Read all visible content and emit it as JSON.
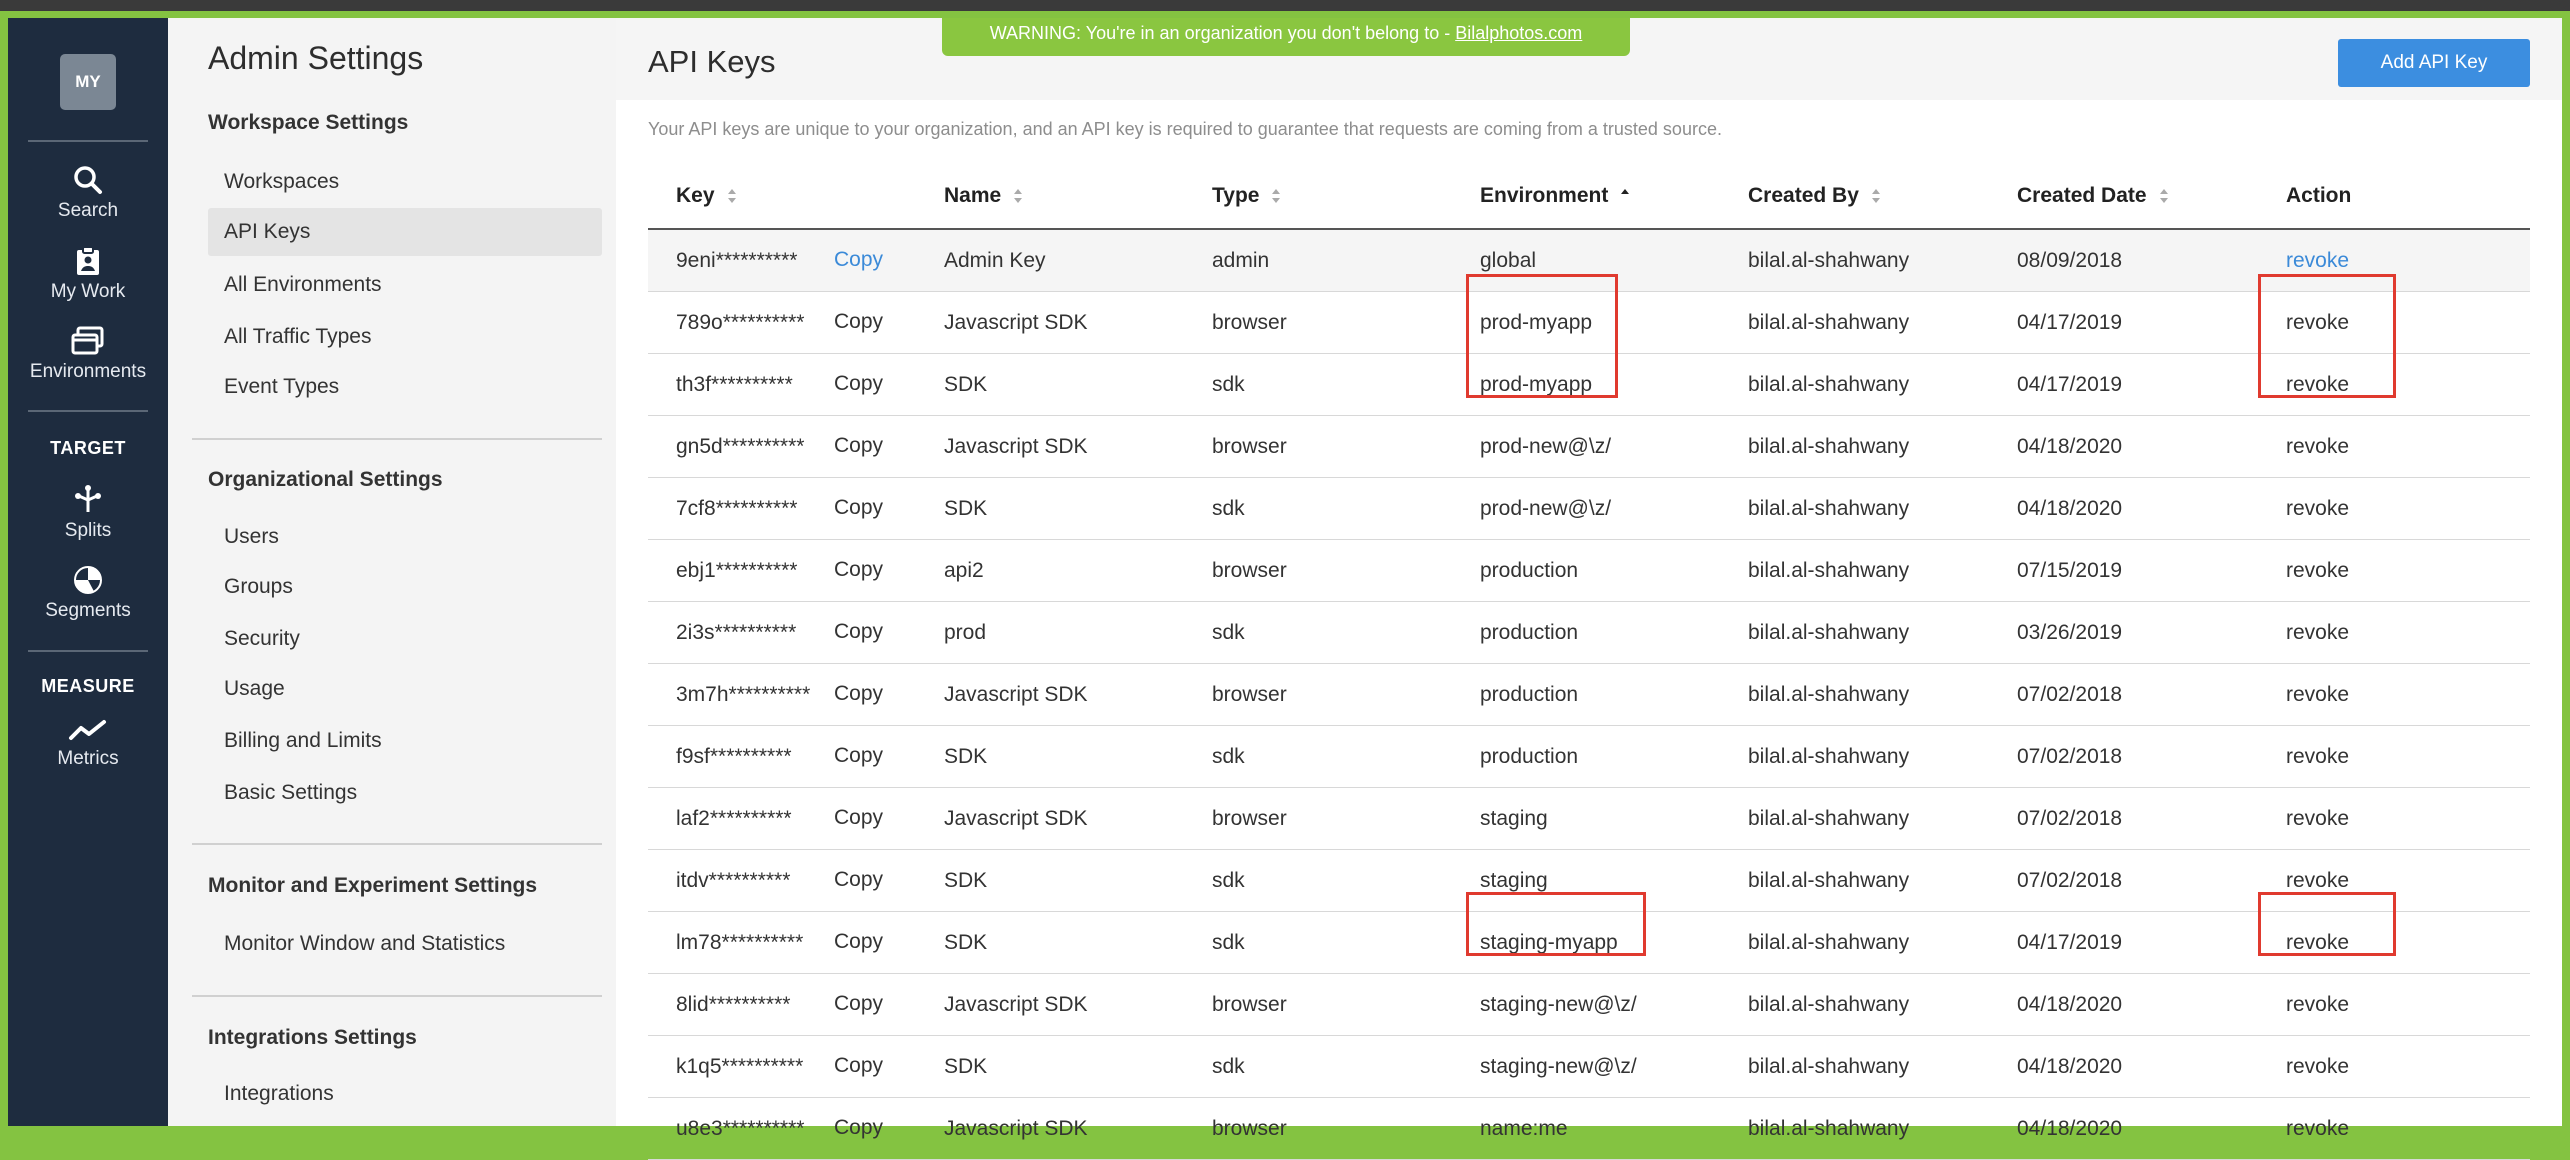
{
  "nav": {
    "avatar": "MY",
    "items": [
      {
        "label": "Search",
        "icon": "search-icon"
      },
      {
        "label": "My Work",
        "icon": "clipboard-icon"
      },
      {
        "label": "Environments",
        "icon": "windows-icon"
      }
    ],
    "target_heading": "TARGET",
    "target_items": [
      {
        "label": "Splits",
        "icon": "splits-icon"
      },
      {
        "label": "Segments",
        "icon": "pie-icon"
      }
    ],
    "measure_heading": "MEASURE",
    "measure_items": [
      {
        "label": "Metrics",
        "icon": "metrics-icon"
      }
    ]
  },
  "settings": {
    "title": "Admin Settings",
    "workspace": {
      "title": "Workspace Settings",
      "items": [
        "Workspaces",
        "API Keys",
        "All Environments",
        "All Traffic Types",
        "Event Types"
      ]
    },
    "org": {
      "title": "Organizational Settings",
      "items": [
        "Users",
        "Groups",
        "Security",
        "Usage",
        "Billing and Limits",
        "Basic Settings"
      ]
    },
    "monitor": {
      "title": "Monitor and Experiment Settings",
      "items": [
        "Monitor Window and Statistics"
      ]
    },
    "integrations": {
      "title": "Integrations Settings",
      "items": [
        "Integrations"
      ]
    }
  },
  "main": {
    "title": "API Keys",
    "add_button": "Add API Key",
    "warning_text": "WARNING: You're in an organization you don't belong to - ",
    "warning_link": "Bilalphotos.com",
    "description": "Your API keys are unique to your organization, and an API key is required to guarantee that requests are coming from a trusted source.",
    "columns": [
      "Key",
      "Name",
      "Type",
      "Environment",
      "Created By",
      "Created Date",
      "Action"
    ],
    "copy_label": "Copy",
    "rows": [
      {
        "key": "9eni**********",
        "name": "Admin Key",
        "type": "admin",
        "env": "global",
        "by": "bilal.al-shahwany",
        "date": "08/09/2018",
        "action": "revoke"
      },
      {
        "key": "789o**********",
        "name": "Javascript SDK",
        "type": "browser",
        "env": "prod-myapp",
        "by": "bilal.al-shahwany",
        "date": "04/17/2019",
        "action": "revoke"
      },
      {
        "key": "th3f**********",
        "name": "SDK",
        "type": "sdk",
        "env": "prod-myapp",
        "by": "bilal.al-shahwany",
        "date": "04/17/2019",
        "action": "revoke"
      },
      {
        "key": "gn5d**********",
        "name": "Javascript SDK",
        "type": "browser",
        "env": "prod-new@\\z/",
        "by": "bilal.al-shahwany",
        "date": "04/18/2020",
        "action": "revoke"
      },
      {
        "key": "7cf8**********",
        "name": "SDK",
        "type": "sdk",
        "env": "prod-new@\\z/",
        "by": "bilal.al-shahwany",
        "date": "04/18/2020",
        "action": "revoke"
      },
      {
        "key": "ebj1**********",
        "name": "api2",
        "type": "browser",
        "env": "production",
        "by": "bilal.al-shahwany",
        "date": "07/15/2019",
        "action": "revoke"
      },
      {
        "key": "2i3s**********",
        "name": "prod",
        "type": "sdk",
        "env": "production",
        "by": "bilal.al-shahwany",
        "date": "03/26/2019",
        "action": "revoke"
      },
      {
        "key": "3m7h**********",
        "name": "Javascript SDK",
        "type": "browser",
        "env": "production",
        "by": "bilal.al-shahwany",
        "date": "07/02/2018",
        "action": "revoke"
      },
      {
        "key": "f9sf**********",
        "name": "SDK",
        "type": "sdk",
        "env": "production",
        "by": "bilal.al-shahwany",
        "date": "07/02/2018",
        "action": "revoke"
      },
      {
        "key": "laf2**********",
        "name": "Javascript SDK",
        "type": "browser",
        "env": "staging",
        "by": "bilal.al-shahwany",
        "date": "07/02/2018",
        "action": "revoke"
      },
      {
        "key": "itdv**********",
        "name": "SDK",
        "type": "sdk",
        "env": "staging",
        "by": "bilal.al-shahwany",
        "date": "07/02/2018",
        "action": "revoke"
      },
      {
        "key": "lm78**********",
        "name": "SDK",
        "type": "sdk",
        "env": "staging-myapp",
        "by": "bilal.al-shahwany",
        "date": "04/17/2019",
        "action": "revoke"
      },
      {
        "key": "8lid**********",
        "name": "Javascript SDK",
        "type": "browser",
        "env": "staging-new@\\z/",
        "by": "bilal.al-shahwany",
        "date": "04/18/2020",
        "action": "revoke"
      },
      {
        "key": "k1q5**********",
        "name": "SDK",
        "type": "sdk",
        "env": "staging-new@\\z/",
        "by": "bilal.al-shahwany",
        "date": "04/18/2020",
        "action": "revoke"
      },
      {
        "key": "u8e3**********",
        "name": "Javascript SDK",
        "type": "browser",
        "env": "name:me",
        "by": "bilal.al-shahwany",
        "date": "04/18/2020",
        "action": "revoke"
      }
    ]
  },
  "colors": {
    "nav_bg": "#1e2c3f",
    "accent_blue": "#3c8ee0",
    "warning_green": "#8ac640",
    "highlight_red": "#e03a2f"
  }
}
